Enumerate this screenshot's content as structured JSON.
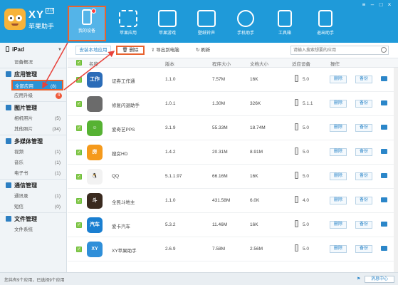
{
  "app": {
    "title": "XY",
    "version": "2.0",
    "subtitle": "苹果助手"
  },
  "nav": [
    {
      "label": "我的设备",
      "icon": "phone-icon",
      "active": true
    },
    {
      "label": "苹果应用",
      "icon": "grid-icon"
    },
    {
      "label": "苹果游戏",
      "icon": "gamepad-icon"
    },
    {
      "label": "壁纸铃声",
      "icon": "image-icon"
    },
    {
      "label": "手机助手",
      "icon": "plus-circle-icon"
    },
    {
      "label": "工具箱",
      "icon": "bag-icon"
    },
    {
      "label": "退出助手",
      "icon": "exit-icon"
    }
  ],
  "window_controls": [
    "≡",
    "–",
    "□",
    "×"
  ],
  "sidebar": {
    "device": "iPad",
    "device_info": "设备概况",
    "groups": [
      {
        "title": "应用管理",
        "items": [
          {
            "label": "全部应用",
            "count": "(8)",
            "active": true
          },
          {
            "label": "应用升级",
            "badge": "4"
          }
        ]
      },
      {
        "title": "图片管理",
        "items": [
          {
            "label": "相机照片",
            "count": "(5)"
          },
          {
            "label": "其他照片",
            "count": "(34)"
          }
        ]
      },
      {
        "title": "多媒体管理",
        "items": [
          {
            "label": "视频",
            "count": "(1)"
          },
          {
            "label": "音乐",
            "count": "(1)"
          },
          {
            "label": "电子书",
            "count": "(1)"
          }
        ]
      },
      {
        "title": "通信管理",
        "items": [
          {
            "label": "通讯录",
            "count": "(1)"
          },
          {
            "label": "短信",
            "count": "(0)"
          }
        ]
      },
      {
        "title": "文件管理",
        "items": [
          {
            "label": "文件系统",
            "count": ""
          }
        ]
      }
    ]
  },
  "toolbar": {
    "install_local": "安装本地应用",
    "delete": "删除",
    "export": "导出到电脑",
    "refresh": "刷新",
    "search_placeholder": "请输入搜索想要的应用"
  },
  "table": {
    "headers": [
      "名称",
      "版本",
      "程序大小",
      "文档大小",
      "适应设备",
      "操作"
    ],
    "rows": [
      {
        "name": "证券工作通",
        "version": "1.1.0",
        "size": "7.57M",
        "doc": "16K",
        "device_ver": "5.0",
        "icon_color": "#2b6cb8",
        "icon_text": "工作"
      },
      {
        "name": "修复闪退助手",
        "version": "1.0.1",
        "size": "1.30M",
        "doc": "326K",
        "device_ver": "5.1.1",
        "icon_color": "#6b6b6b",
        "icon_text": ""
      },
      {
        "name": "爱奇艺PPS",
        "version": "3.1.9",
        "size": "55.33M",
        "doc": "18.74M",
        "device_ver": "5.0",
        "icon_color": "#56b233",
        "icon_text": "☺"
      },
      {
        "name": "搜房HD",
        "version": "1.4.2",
        "size": "20.31M",
        "doc": "8.91M",
        "device_ver": "5.0",
        "icon_color": "#f59a1c",
        "icon_text": "房"
      },
      {
        "name": "QQ",
        "version": "5.1.1.97",
        "size": "66.16M",
        "doc": "16K",
        "device_ver": "5.0",
        "icon_color": "#f2f2f2",
        "icon_text": "🐧"
      },
      {
        "name": "全民斗地主",
        "version": "1.1.0",
        "size": "431.58M",
        "doc": "6.0K",
        "device_ver": "4.0",
        "icon_color": "#3a2a1f",
        "icon_text": "斗"
      },
      {
        "name": "爱卡汽车",
        "version": "5.3.2",
        "size": "11.46M",
        "doc": "16K",
        "device_ver": "5.0",
        "icon_color": "#1a7fd1",
        "icon_text": "汽车"
      },
      {
        "name": "XY苹果助手",
        "version": "2.6.9",
        "size": "7.58M",
        "doc": "2.56M",
        "device_ver": "5.0",
        "icon_color": "#2f8fd9",
        "icon_text": "XY"
      }
    ],
    "action_delete": "删除",
    "action_backup": "备份"
  },
  "status": {
    "text": "您共有9个应用，已选择9个应用",
    "message_center": "消息中心"
  },
  "colors": {
    "topbar": "#1f9ad9",
    "accent": "#2b86c9",
    "highlight": "#e8622f",
    "check": "#8cc94f"
  }
}
